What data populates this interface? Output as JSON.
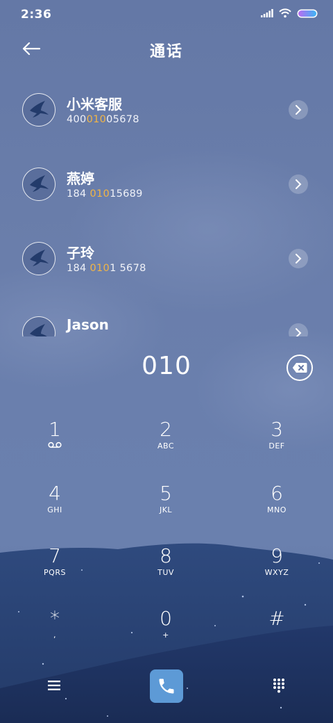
{
  "status": {
    "time": "2:36"
  },
  "header": {
    "title": "通话"
  },
  "contacts": [
    {
      "name": "小米客服",
      "num_pre": "400",
      "num_hl": "010",
      "num_post": "05678"
    },
    {
      "name": "燕婷",
      "num_pre": "184 ",
      "num_hl": "010",
      "num_post": "15689"
    },
    {
      "name": "子玲",
      "num_pre": "184 ",
      "num_hl": "010",
      "num_post": "1 5678"
    },
    {
      "name": "Jason",
      "num_pre": "",
      "num_hl": "",
      "num_post": ""
    }
  ],
  "dialer": {
    "number": "010"
  },
  "keypad": [
    {
      "digit": "1",
      "letters": ""
    },
    {
      "digit": "2",
      "letters": "ABC"
    },
    {
      "digit": "3",
      "letters": "DEF"
    },
    {
      "digit": "4",
      "letters": "GHI"
    },
    {
      "digit": "5",
      "letters": "JKL"
    },
    {
      "digit": "6",
      "letters": "MNO"
    },
    {
      "digit": "7",
      "letters": "PQRS"
    },
    {
      "digit": "8",
      "letters": "TUV"
    },
    {
      "digit": "9",
      "letters": "WXYZ"
    },
    {
      "digit": "*",
      "letters": ","
    },
    {
      "digit": "0",
      "letters": "+"
    },
    {
      "digit": "#",
      "letters": ""
    }
  ],
  "colors": {
    "highlight": "#f2b545",
    "call_button": "#5d9ad6"
  },
  "icons": {
    "back": "arrow-left-icon",
    "chevron": "chevron-right-icon",
    "backspace": "backspace-icon",
    "voicemail": "voicemail-icon",
    "menu": "menu-icon",
    "call": "phone-icon",
    "dialpad": "dialpad-icon"
  }
}
